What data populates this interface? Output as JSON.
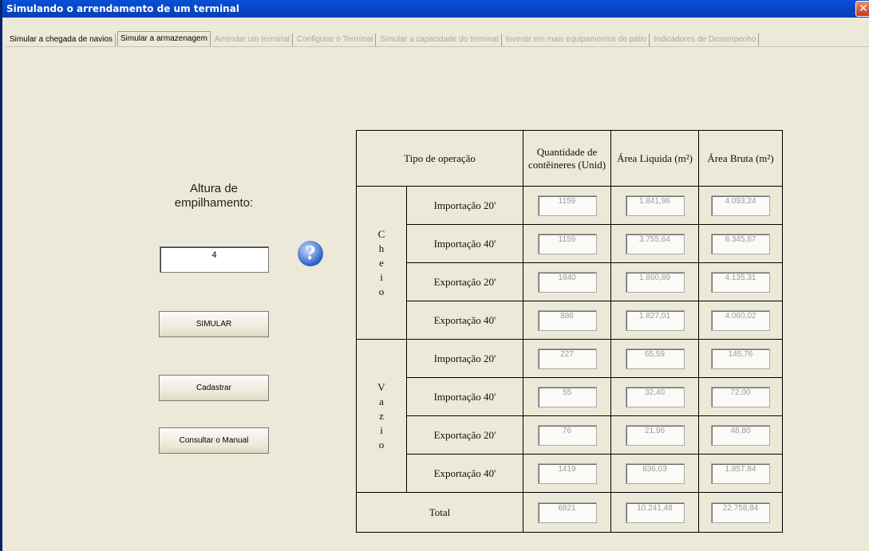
{
  "window": {
    "title": "Simulando o arrendamento de um terminal",
    "close_glyph": "✕"
  },
  "tabs": [
    {
      "label": "Simular a chegada de navios",
      "state": "enabled"
    },
    {
      "label": "Simular a armazenagem",
      "state": "active"
    },
    {
      "label": "Arrendar um terminal",
      "state": "disabled"
    },
    {
      "label": "Configurar o Terminal",
      "state": "disabled"
    },
    {
      "label": "Simular a capacidade do terminal",
      "state": "disabled"
    },
    {
      "label": "Investir em mais equipamentos de pátio",
      "state": "disabled"
    },
    {
      "label": "Indicadores de Desempenho",
      "state": "disabled"
    }
  ],
  "left": {
    "altura_label": "Altura de empilhamento:",
    "altura_value": "4",
    "help_glyph": "?",
    "simular_button": "SIMULAR",
    "cadastrar_button": "Cadastrar",
    "manual_button": "Consultar o Manual"
  },
  "table": {
    "headers": {
      "tipo": "Tipo de operação",
      "quantidade": "Quantidade de contêineres (Unid)",
      "area_liquida": "Área Liquida (m²)",
      "area_bruta": "Área Bruta (m²)"
    },
    "groups": {
      "cheio": "Cheio",
      "vazio": "Vazio"
    },
    "rows": [
      {
        "op": "Importação 20'",
        "qty": "1159",
        "liq": "1.841,96",
        "bruta": "4.093,24"
      },
      {
        "op": "Importação 40'",
        "qty": "1159",
        "liq": "3.755,64",
        "bruta": "8.345,87"
      },
      {
        "op": "Exportação 20'",
        "qty": "1840",
        "liq": "1.860,89",
        "bruta": "4.135,31"
      },
      {
        "op": "Exportação 40'",
        "qty": "886",
        "liq": "1.827,01",
        "bruta": "4.060,02"
      },
      {
        "op": "Importação 20'",
        "qty": "227",
        "liq": "65,59",
        "bruta": "145,76"
      },
      {
        "op": "Importação 40'",
        "qty": "55",
        "liq": "32,40",
        "bruta": "72,00"
      },
      {
        "op": "Exportação 20'",
        "qty": "76",
        "liq": "21,96",
        "bruta": "48,80"
      },
      {
        "op": "Exportação 40'",
        "qty": "1419",
        "liq": "836,03",
        "bruta": "1.857,84"
      }
    ],
    "total": {
      "label": "Total",
      "qty": "6821",
      "liq": "10.241,48",
      "bruta": "22.758,84"
    }
  }
}
